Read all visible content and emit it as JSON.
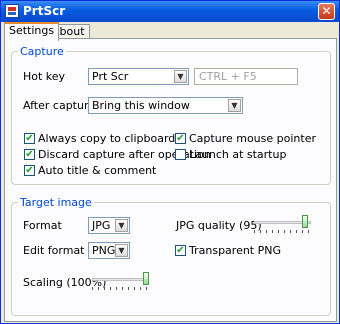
{
  "window": {
    "title": "PrtScr",
    "close_glyph": "✕",
    "icon": "prtscr-app-icon"
  },
  "tabs": [
    {
      "label": "Settings",
      "active": true
    },
    {
      "label": "About",
      "active": false
    }
  ],
  "capture": {
    "legend": "Capture",
    "hotkey_label": "Hot key",
    "hotkey_value": "Prt Scr",
    "hotkey_alt": "CTRL + F5",
    "after_label": "After capture",
    "after_value": "Bring this window",
    "checks": [
      {
        "label": "Always copy to clipboard",
        "checked": true
      },
      {
        "label": "Capture mouse pointer",
        "checked": true
      },
      {
        "label": "Discard capture after operation",
        "checked": true
      },
      {
        "label": "Launch at startup",
        "checked": false
      },
      {
        "label": "Auto title & comment",
        "checked": true
      }
    ]
  },
  "target": {
    "legend": "Target image",
    "format_label": "Format",
    "format_value": "JPG",
    "edit_label": "Edit format",
    "edit_value": "PNG",
    "quality_label": "JPG quality (95)",
    "quality_level": 0.95,
    "transparent_label": "Transparent PNG",
    "transparent_checked": true,
    "scaling_label": "Scaling (100%)",
    "scaling_level": 1.0
  },
  "check_glyph": "✔",
  "arrow_glyph": "▼"
}
